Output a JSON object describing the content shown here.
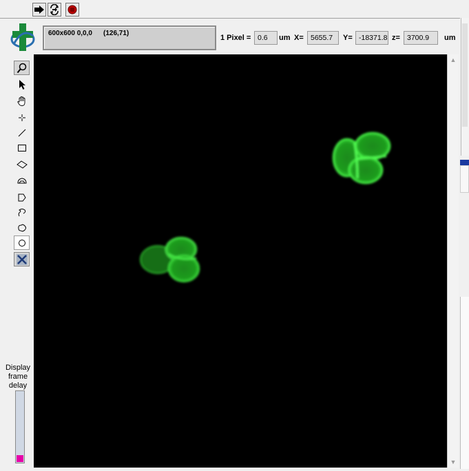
{
  "toolbar": {
    "buttons": [
      {
        "name": "run-arrow-icon"
      },
      {
        "name": "run-continuous-icon"
      },
      {
        "name": "abort-stop-icon"
      }
    ]
  },
  "status": {
    "image_info": "600x600 0,0,0",
    "cursor_coords": "(126,71)"
  },
  "calibration": {
    "pixel_label": "1 Pixel =",
    "pixel_value": "0.6",
    "unit1": "um",
    "x_label": "X=",
    "x_value": "5655.7",
    "y_label": "Y=",
    "y_value": "-18371.8",
    "z_label": "z=",
    "z_value": "3700.9",
    "unit2": "um"
  },
  "tools": [
    {
      "name": "zoom-tool-icon"
    },
    {
      "name": "pointer-tool-icon"
    },
    {
      "name": "pan-hand-icon"
    },
    {
      "name": "point-crosshair-icon"
    },
    {
      "name": "line-tool-icon"
    },
    {
      "name": "rectangle-tool-icon"
    },
    {
      "name": "rotated-rectangle-icon"
    },
    {
      "name": "annulus-tool-icon"
    },
    {
      "name": "polygon-tool-icon"
    },
    {
      "name": "freehand-line-icon"
    },
    {
      "name": "freehand-region-icon"
    },
    {
      "name": "oval-tool-icon",
      "active": true
    },
    {
      "name": "clear-roi-icon"
    }
  ],
  "display_frame_delay": {
    "label_line1": "Display",
    "label_line2": "frame",
    "label_line3": "delay",
    "level_percent": 10
  },
  "colors": {
    "cell_green": "#33dd33",
    "canvas_background": "#000000",
    "slider_indicator": "#e600a8"
  }
}
